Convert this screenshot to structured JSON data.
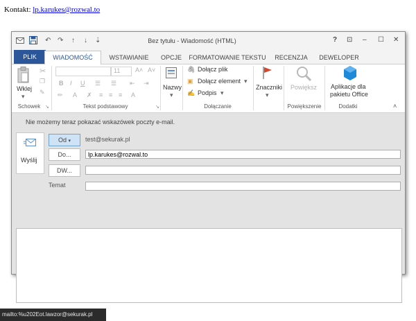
{
  "page": {
    "contact_label": "Kontakt:",
    "contact_email": "lp.karukes@rozwal.to"
  },
  "window": {
    "title": "Bez tytułu - Wiadomość (HTML)",
    "controls": {
      "help": "?",
      "ribbon_options": "⊡",
      "minimize": "–",
      "restore": "☐",
      "close": "✕"
    },
    "quick_access": {
      "undo": "↶",
      "redo": "↷",
      "up": "↑",
      "down": "↓",
      "customize": "⇣"
    }
  },
  "tabs": [
    "PLIK",
    "WIADOMOŚĆ",
    "WSTAWIANIE",
    "OPCJE",
    "FORMATOWANIE TEKSTU",
    "RECENZJA",
    "DEWELOPER"
  ],
  "ribbon": {
    "clipboard": {
      "paste": "Wklej",
      "group": "Schowek"
    },
    "basic_text": {
      "font_size": "11",
      "bold": "B",
      "italic": "I",
      "underline": "U",
      "group": "Tekst podstawowy"
    },
    "names": {
      "label": "Nazwy"
    },
    "include": {
      "attach_file": "Dołącz plik",
      "attach_item": "Dołącz element",
      "signature": "Podpis",
      "group": "Dołączanie"
    },
    "tags": {
      "label": "Znaczniki"
    },
    "zoom": {
      "label": "Powiększ",
      "group": "Powiększenie"
    },
    "addins": {
      "line1": "Aplikacje dla",
      "line2": "pakietu Office",
      "group": "Dodatki"
    }
  },
  "compose": {
    "info": "Nie możemy teraz pokazać wskazówek poczty e-mail.",
    "send": "Wyślij",
    "from_button": "Od",
    "from_value": "test@sekurak.pl",
    "to_button": "Do...",
    "to_value": "lp.karukes@rozwal.to",
    "cc_button": "DW...",
    "cc_value": "",
    "subject_label": "Temat",
    "subject_value": ""
  },
  "statusbar": {
    "url": "mailto:%u202Eot.lawzor@sekurak.pl"
  },
  "colors": {
    "accent": "#2b579a",
    "office_logo": "#1e88d9",
    "flag": "#d9452b"
  }
}
